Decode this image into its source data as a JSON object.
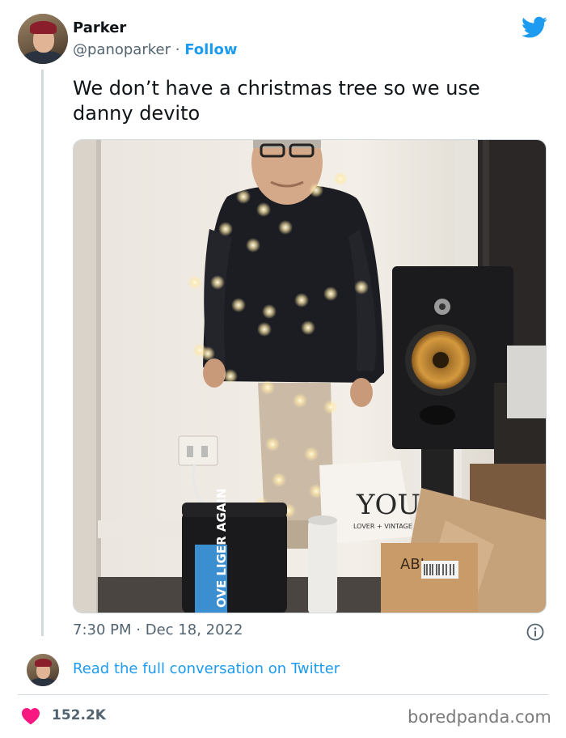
{
  "author": {
    "name": "Parker",
    "handle": "@panoparker",
    "separator": "·",
    "follow_label": "Follow"
  },
  "tweet": {
    "text": "We don’t have a christmas tree so we use danny devito",
    "time": "7:30 PM",
    "separator": "·",
    "date": "Dec 18, 2022"
  },
  "photo": {
    "bag_brand": "YOU",
    "bag_tagline": "LOVER + VINTAGE",
    "box_label": "ABI",
    "cooler_text": "OVE LIGER AGAIN"
  },
  "footer": {
    "read_more_label": "Read the full conversation on Twitter",
    "like_count": "152.2K",
    "watermark": "boredpanda.com"
  },
  "icons": {
    "bird": "twitter-bird-icon",
    "info": "info-icon",
    "heart": "heart-icon"
  },
  "colors": {
    "link_blue": "#1d9bf0",
    "heart_red": "#f91880",
    "muted_text": "#536471"
  }
}
